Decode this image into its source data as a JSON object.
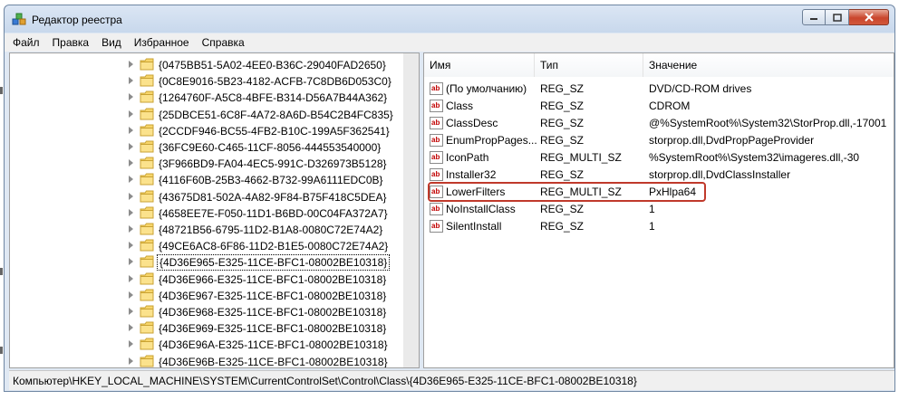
{
  "window": {
    "title": "Редактор реестра"
  },
  "menu": [
    "Файл",
    "Правка",
    "Вид",
    "Избранное",
    "Справка"
  ],
  "tree": {
    "items": [
      {
        "label": "{0475BB51-5A02-4EE0-B36C-29040FAD2650}"
      },
      {
        "label": "{0C8E9016-5B23-4182-ACFB-7C8DB6D053C0}"
      },
      {
        "label": "{1264760F-A5C8-4BFE-B314-D56A7B44A362}"
      },
      {
        "label": "{25DBCE51-6C8F-4A72-8A6D-B54C2B4FC835}"
      },
      {
        "label": "{2CCDF946-BC55-4FB2-B10C-199A5F362541}"
      },
      {
        "label": "{36FC9E60-C465-11CF-8056-444553540000}"
      },
      {
        "label": "{3F966BD9-FA04-4EC5-991C-D326973B5128}"
      },
      {
        "label": "{4116F60B-25B3-4662-B732-99A6111EDC0B}"
      },
      {
        "label": "{43675D81-502A-4A82-9F84-B75F418C5DEA}"
      },
      {
        "label": "{4658EE7E-F050-11D1-B6BD-00C04FA372A7}"
      },
      {
        "label": "{48721B56-6795-11D2-B1A8-0080C72E74A2}"
      },
      {
        "label": "{49CE6AC8-6F86-11D2-B1E5-0080C72E74A2}"
      },
      {
        "label": "{4D36E965-E325-11CE-BFC1-08002BE10318}",
        "selected": true
      },
      {
        "label": "{4D36E966-E325-11CE-BFC1-08002BE10318}"
      },
      {
        "label": "{4D36E967-E325-11CE-BFC1-08002BE10318}"
      },
      {
        "label": "{4D36E968-E325-11CE-BFC1-08002BE10318}"
      },
      {
        "label": "{4D36E969-E325-11CE-BFC1-08002BE10318}"
      },
      {
        "label": "{4D36E96A-E325-11CE-BFC1-08002BE10318}"
      },
      {
        "label": "{4D36E96B-E325-11CE-BFC1-08002BE10318}"
      }
    ]
  },
  "values": {
    "columns": {
      "name": "Имя",
      "type": "Тип",
      "data": "Значение"
    },
    "rows": [
      {
        "name": "(По умолчанию)",
        "type": "REG_SZ",
        "data": "DVD/CD-ROM drives"
      },
      {
        "name": "Class",
        "type": "REG_SZ",
        "data": "CDROM"
      },
      {
        "name": "ClassDesc",
        "type": "REG_SZ",
        "data": "@%SystemRoot%\\System32\\StorProp.dll,-17001"
      },
      {
        "name": "EnumPropPages...",
        "type": "REG_SZ",
        "data": "storprop.dll,DvdPropPageProvider"
      },
      {
        "name": "IconPath",
        "type": "REG_MULTI_SZ",
        "data": "%SystemRoot%\\System32\\imageres.dll,-30"
      },
      {
        "name": "Installer32",
        "type": "REG_SZ",
        "data": "storprop.dll,DvdClassInstaller"
      },
      {
        "name": "LowerFilters",
        "type": "REG_MULTI_SZ",
        "data": "PxHlpa64",
        "highlighted": true
      },
      {
        "name": "NoInstallClass",
        "type": "REG_SZ",
        "data": "1"
      },
      {
        "name": "SilentInstall",
        "type": "REG_SZ",
        "data": "1"
      }
    ]
  },
  "status": {
    "path": "Компьютер\\HKEY_LOCAL_MACHINE\\SYSTEM\\CurrentControlSet\\Control\\Class\\{4D36E965-E325-11CE-BFC1-08002BE10318}"
  },
  "icons": {
    "value_icon": "ab-string-icon",
    "folder_icon": "folder-icon",
    "app_icon": "regedit-icon"
  },
  "colors": {
    "highlight_border": "#c0392b",
    "close_button": "#c9462c"
  }
}
